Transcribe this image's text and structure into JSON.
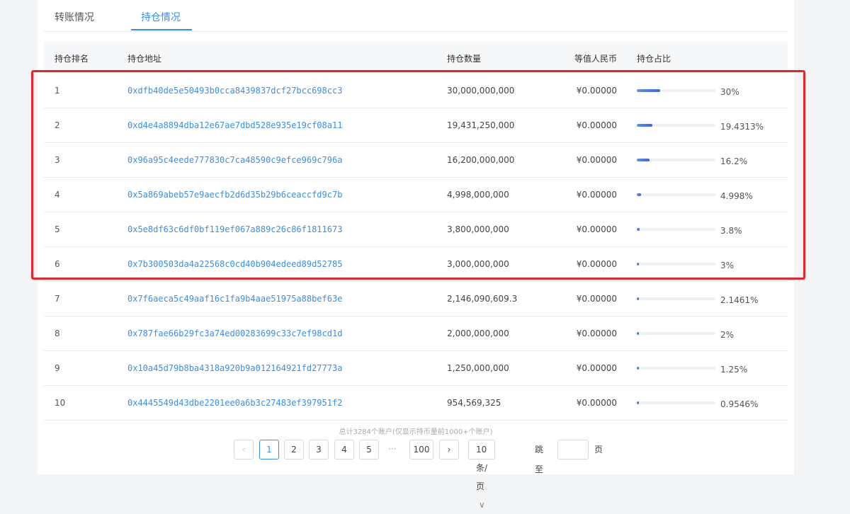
{
  "tabs": [
    {
      "label": "转账情况"
    },
    {
      "label": "持仓情况"
    }
  ],
  "table": {
    "headers": {
      "rank": "持仓排名",
      "address": "持仓地址",
      "quantity": "持仓数量",
      "cny": "等值人民币",
      "ratio": "持仓占比"
    },
    "rows": [
      {
        "rank": "1",
        "address": "0xdfb40de5e50493b0cca8439837dcf27bcc698cc3",
        "quantity": "30,000,000,000",
        "cny": "¥0.00000",
        "percent": "30%",
        "ratio": 0.3
      },
      {
        "rank": "2",
        "address": "0xd4e4a8894dba12e67ae7dbd528e935e19cf08a11",
        "quantity": "19,431,250,000",
        "cny": "¥0.00000",
        "percent": "19.4313%",
        "ratio": 0.194313
      },
      {
        "rank": "3",
        "address": "0x96a95c4eede777830c7ca48590c9efce969c796a",
        "quantity": "16,200,000,000",
        "cny": "¥0.00000",
        "percent": "16.2%",
        "ratio": 0.162
      },
      {
        "rank": "4",
        "address": "0x5a869abeb57e9aecfb2d6d35b29b6ceaccfd9c7b",
        "quantity": "4,998,000,000",
        "cny": "¥0.00000",
        "percent": "4.998%",
        "ratio": 0.04998
      },
      {
        "rank": "5",
        "address": "0x5e8df63c6df0bf119ef067a889c26c86f1811673",
        "quantity": "3,800,000,000",
        "cny": "¥0.00000",
        "percent": "3.8%",
        "ratio": 0.038
      },
      {
        "rank": "6",
        "address": "0x7b300503da4a22568c0cd40b904edeed89d52785",
        "quantity": "3,000,000,000",
        "cny": "¥0.00000",
        "percent": "3%",
        "ratio": 0.03
      },
      {
        "rank": "7",
        "address": "0x7f6aeca5c49aaf16c1fa9b4aae51975a88bef63e",
        "quantity": "2,146,090,609.3",
        "cny": "¥0.00000",
        "percent": "2.1461%",
        "ratio": 0.021461
      },
      {
        "rank": "8",
        "address": "0x787fae66b29fc3a74ed00283699c33c7ef98cd1d",
        "quantity": "2,000,000,000",
        "cny": "¥0.00000",
        "percent": "2%",
        "ratio": 0.02
      },
      {
        "rank": "9",
        "address": "0x10a45d79b8ba4318a920b9a012164921fd27773a",
        "quantity": "1,250,000,000",
        "cny": "¥0.00000",
        "percent": "1.25%",
        "ratio": 0.0125
      },
      {
        "rank": "10",
        "address": "0x4445549d43dbe2201ee0a6b3c27483ef397951f2",
        "quantity": "954,569,325",
        "cny": "¥0.00000",
        "percent": "0.9546%",
        "ratio": 0.009546
      }
    ]
  },
  "footer": {
    "total": "总计3284个账户(仅显示持币量前1000+个账户)",
    "pages": [
      "1",
      "2",
      "3",
      "4",
      "5"
    ],
    "last_page": "100",
    "ellipsis": "···",
    "page_size": "10 条/页",
    "jump_label": "跳至",
    "page_suffix": "页",
    "prev_icon": "‹",
    "next_icon": "›"
  },
  "colors": {
    "accent": "#3b8fe6",
    "highlight_box": "#e6262a"
  }
}
